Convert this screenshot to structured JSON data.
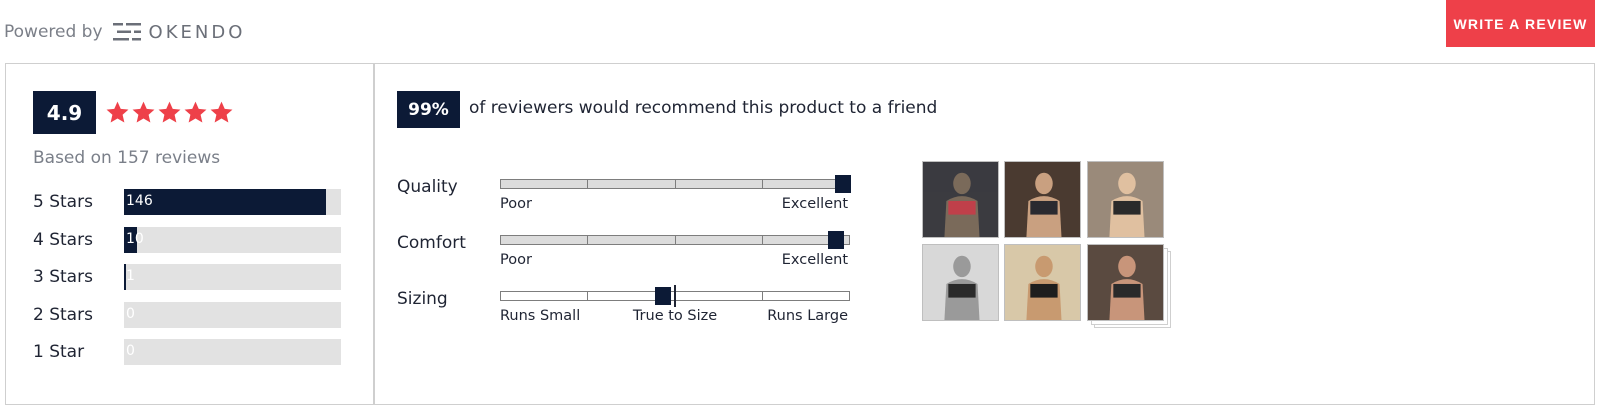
{
  "header": {
    "powered_by": "Powered by",
    "brand": "OKENDO",
    "write_review": "WRITE A REVIEW"
  },
  "summary": {
    "rating": "4.9",
    "star_count": 5,
    "based_on": "Based on 157 reviews",
    "distribution": [
      {
        "label": "5 Stars",
        "count": "146",
        "fraction": 0.93
      },
      {
        "label": "4 Stars",
        "count": "10",
        "fraction": 0.06
      },
      {
        "label": "3 Stars",
        "count": "1",
        "fraction": 0.01
      },
      {
        "label": "2 Stars",
        "count": "0",
        "fraction": 0
      },
      {
        "label": "1 Star",
        "count": "0",
        "fraction": 0
      }
    ]
  },
  "recommend": {
    "percent": "99%",
    "text": "of reviewers would recommend this product to a friend"
  },
  "attributes": [
    {
      "label": "Quality",
      "min": "Poor",
      "max": "Excellent",
      "value": 1.0
    },
    {
      "label": "Comfort",
      "min": "Poor",
      "max": "Excellent",
      "value": 0.98
    },
    {
      "label": "Sizing",
      "min": "Runs Small",
      "mid": "True to Size",
      "max": "Runs Large",
      "value": 0.46
    }
  ],
  "media": {
    "thumbnails": [
      "review-photo-1",
      "review-photo-2",
      "review-photo-3",
      "review-photo-4",
      "review-photo-5",
      "review-photo-6"
    ]
  },
  "colors": {
    "brand_navy": "#0c1a36",
    "star_red": "#ee4049",
    "button_red": "#ee4049",
    "track_gray": "#e2e2e2"
  },
  "icons": {
    "star": "star-icon",
    "logo": "okendo-logo-icon"
  }
}
